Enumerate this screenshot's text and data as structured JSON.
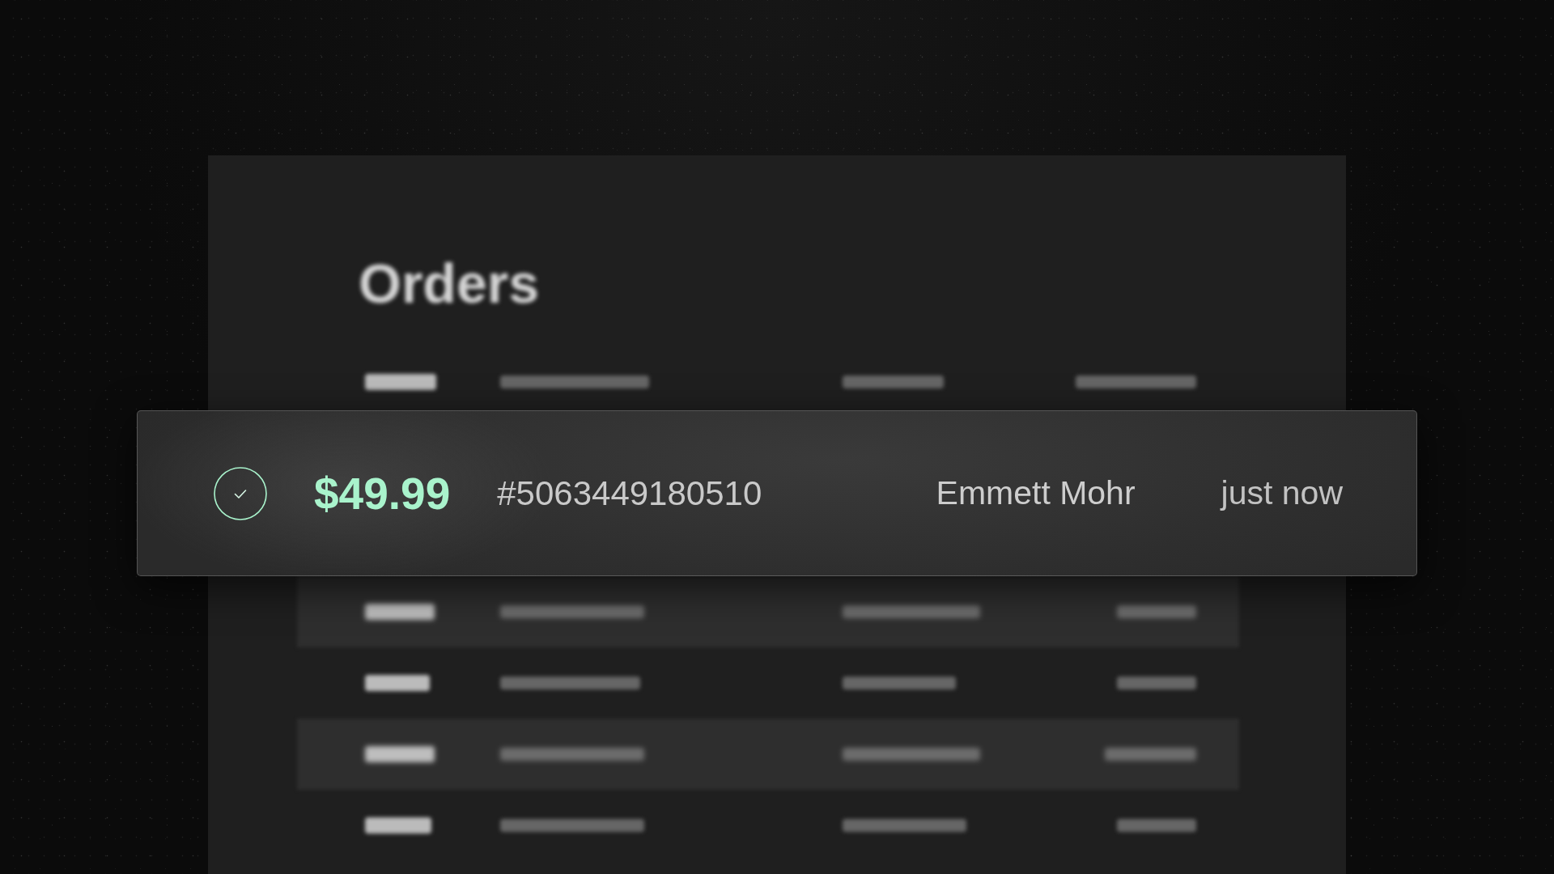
{
  "orders_panel": {
    "title": "Orders",
    "rows_above": [
      {
        "shaded": false
      }
    ],
    "notification": {
      "amount": "$49.99",
      "order_number": "#5063449180510",
      "customer": "Emmett Mohr",
      "time": "just now"
    },
    "rows_below": [
      {
        "shaded": true
      },
      {
        "shaded": false
      },
      {
        "shaded": true
      },
      {
        "shaded": false
      }
    ]
  }
}
